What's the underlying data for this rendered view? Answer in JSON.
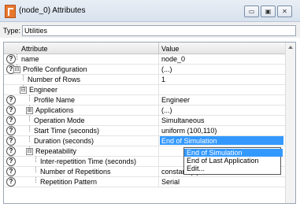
{
  "window": {
    "title": "(node_0) Attributes",
    "min_symbol": "▭",
    "max_symbol": "▣",
    "close_symbol": "✕"
  },
  "type_bar": {
    "label": "Type:",
    "value": "Utilities"
  },
  "grid": {
    "columns": [
      "Attribute",
      "Value"
    ],
    "rows": [
      {
        "attr": "name",
        "value": "node_0",
        "help": true
      },
      {
        "attr": "Profile Configuration",
        "value": "(...)",
        "help": true,
        "expander": "⊟"
      },
      {
        "attr": "Number of Rows",
        "value": "1",
        "help": false
      },
      {
        "attr": "Engineer",
        "value": "",
        "help": false,
        "expander": "⊟"
      },
      {
        "attr": "Profile Name",
        "value": "Engineer",
        "help": true
      },
      {
        "attr": "Applications",
        "value": "(...)",
        "help": true,
        "expander": "⊞"
      },
      {
        "attr": "Operation Mode",
        "value": "Simultaneous",
        "help": true
      },
      {
        "attr": "Start Time (seconds)",
        "value": "uniform (100,110)",
        "help": true
      },
      {
        "attr": "Duration (seconds)",
        "value": "End of Simulation",
        "help": true,
        "selected": true
      },
      {
        "attr": "Repeatability",
        "value": "",
        "help": true,
        "expander": "⊟"
      },
      {
        "attr": "Inter-repetition Time (seconds)",
        "value": "",
        "help": true
      },
      {
        "attr": "Number of Repetitions",
        "value": "constant (0)",
        "help": true
      },
      {
        "attr": "Repetition Pattern",
        "value": "Serial",
        "help": true
      }
    ],
    "help_symbol": "?"
  },
  "dropdown": {
    "options": [
      "End of Simulation",
      "End of Last Application",
      "Edit..."
    ],
    "active_index": 0
  }
}
